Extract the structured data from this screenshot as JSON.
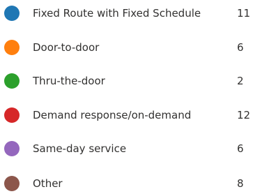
{
  "legend": {
    "items": [
      {
        "label": "Fixed Route with Fixed Schedule",
        "count": "11",
        "color": "#1f77b4"
      },
      {
        "label": "Door-to-door",
        "count": "6",
        "color": "#ff7f0e"
      },
      {
        "label": "Thru-the-door",
        "count": "2",
        "color": "#2ca02c"
      },
      {
        "label": "Demand response/on-demand",
        "count": "12",
        "color": "#d62728"
      },
      {
        "label": "Same-day service",
        "count": "6",
        "color": "#9467bd"
      },
      {
        "label": "Other",
        "count": "8",
        "color": "#8c564b"
      }
    ]
  }
}
